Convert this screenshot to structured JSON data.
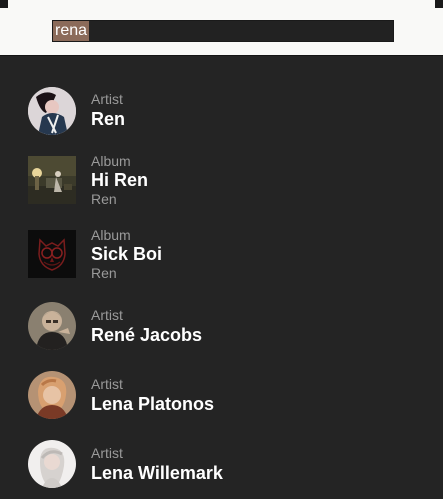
{
  "search": {
    "query": "rena"
  },
  "results": [
    {
      "kind": "Artist",
      "title": "Ren",
      "subtitle": "",
      "thumb_shape": "round",
      "thumb_icon": "artist-portrait-icon"
    },
    {
      "kind": "Album",
      "title": "Hi Ren",
      "subtitle": "Ren",
      "thumb_shape": "square",
      "thumb_icon": "album-cover-icon"
    },
    {
      "kind": "Album",
      "title": "Sick Boi",
      "subtitle": "Ren",
      "thumb_shape": "square",
      "thumb_icon": "owl-logo-icon"
    },
    {
      "kind": "Artist",
      "title": "René Jacobs",
      "subtitle": "",
      "thumb_shape": "round",
      "thumb_icon": "artist-portrait-icon"
    },
    {
      "kind": "Artist",
      "title": "Lena Platonos",
      "subtitle": "",
      "thumb_shape": "round",
      "thumb_icon": "artist-portrait-icon"
    },
    {
      "kind": "Artist",
      "title": "Lena Willemark",
      "subtitle": "",
      "thumb_shape": "round",
      "thumb_icon": "artist-portrait-icon"
    }
  ],
  "colors": {
    "background": "#242424",
    "topbar": "#f9f9f7",
    "selection": "#8b6b5a",
    "secondary_text": "#9a9a9a",
    "primary_text": "#ffffff"
  }
}
